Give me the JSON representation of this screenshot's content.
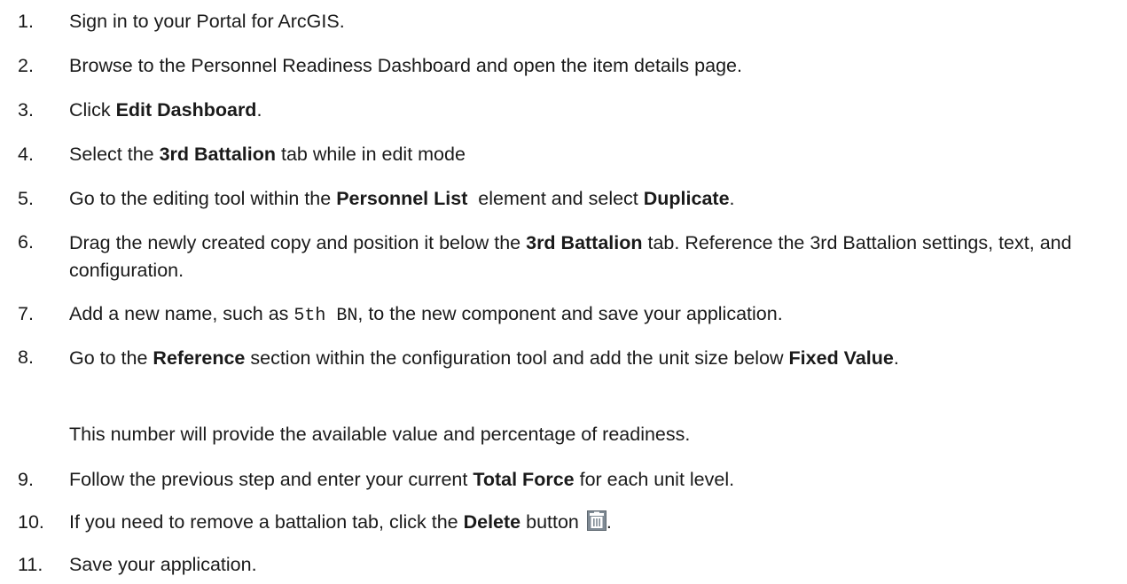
{
  "steps": [
    {
      "num": "1.",
      "parts": [
        {
          "t": "Sign in to your Portal for ArcGIS."
        }
      ]
    },
    {
      "num": "2.",
      "parts": [
        {
          "t": "Browse to the Personnel Readiness Dashboard and open the item details page."
        }
      ]
    },
    {
      "num": "3.",
      "parts": [
        {
          "t": "Click "
        },
        {
          "t": "Edit Dashboard",
          "b": true
        },
        {
          "t": "."
        }
      ]
    },
    {
      "num": "4.",
      "parts": [
        {
          "t": "Select the "
        },
        {
          "t": "3rd Battalion",
          "b": true
        },
        {
          "t": " tab while in edit mode"
        }
      ]
    },
    {
      "num": "5.",
      "parts": [
        {
          "t": "Go to the editing tool within the "
        },
        {
          "t": "Personnel List",
          "b": true
        },
        {
          "t": "  element and select "
        },
        {
          "t": "Duplicate",
          "b": true
        },
        {
          "t": "."
        }
      ]
    },
    {
      "num": "6.",
      "parts": [
        {
          "t": "Drag the newly created copy and position it below the "
        },
        {
          "t": "3rd Battalion",
          "b": true
        },
        {
          "t": " tab. Reference the 3rd Battalion settings, text, and configuration."
        }
      ]
    },
    {
      "num": "7.",
      "parts": [
        {
          "t": "Add a new name, such as "
        },
        {
          "t": "5th BN",
          "m": true
        },
        {
          "t": ", to the new component and save your application."
        }
      ]
    },
    {
      "num": "8.",
      "parts": [
        {
          "t": "Go to the "
        },
        {
          "t": "Reference",
          "b": true
        },
        {
          "t": " section within the configuration tool and add the unit size below "
        },
        {
          "t": "Fixed Value",
          "b": true
        },
        {
          "t": "."
        }
      ]
    },
    {
      "num": "9.",
      "parts": [
        {
          "t": "Follow the previous step and enter your current "
        },
        {
          "t": "Total Force",
          "b": true
        },
        {
          "t": " for each unit level."
        }
      ]
    },
    {
      "num": "10.",
      "parts": [
        {
          "t": "If you need to remove a battalion tab, click the "
        },
        {
          "t": "Delete",
          "b": true
        },
        {
          "t": " button "
        },
        {
          "icon": "trash-icon"
        },
        {
          "t": "."
        }
      ]
    },
    {
      "num": "11.",
      "parts": [
        {
          "t": "Save your application."
        }
      ]
    }
  ],
  "note": "This number will provide the available value and percentage of readiness."
}
